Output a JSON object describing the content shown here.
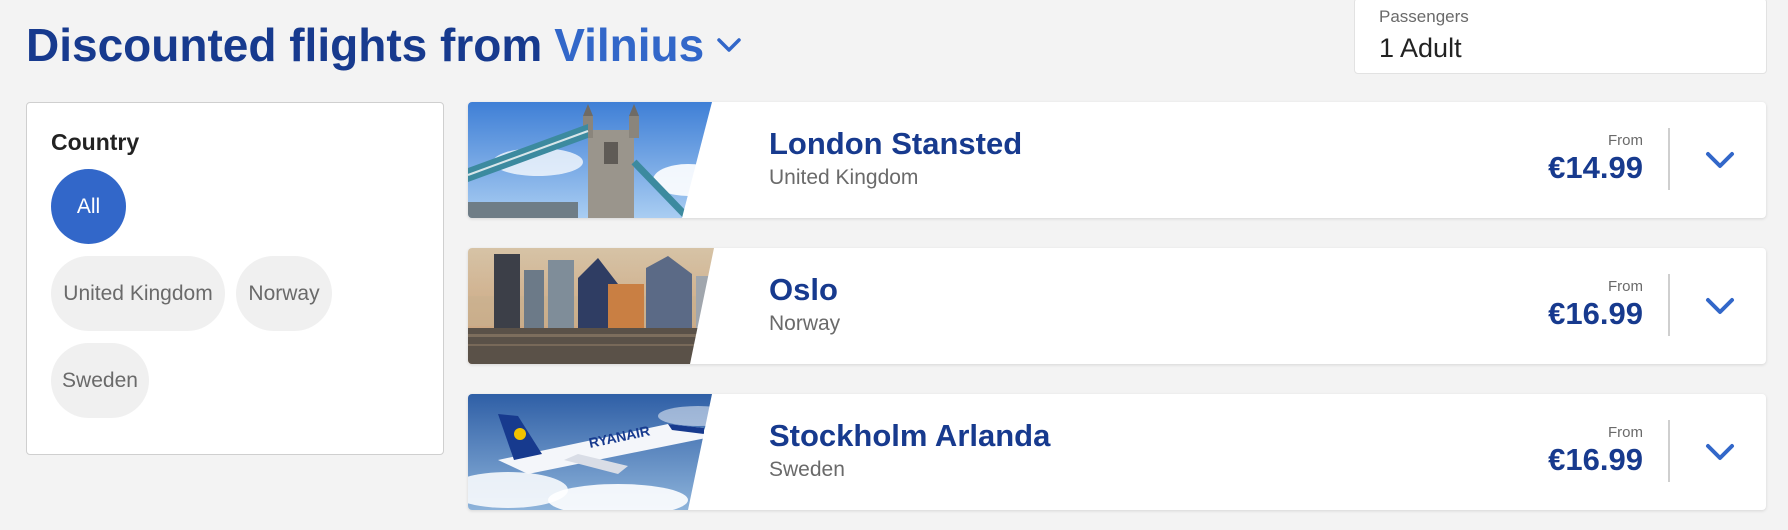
{
  "header": {
    "title_prefix": "Discounted flights from",
    "origin_city": "Vilnius"
  },
  "passengers": {
    "label": "Passengers",
    "value": "1 Adult"
  },
  "filter": {
    "heading": "Country",
    "chips": [
      {
        "label": "All",
        "active": true
      },
      {
        "label": "United Kingdom",
        "active": false
      },
      {
        "label": "Norway",
        "active": false
      },
      {
        "label": "Sweden",
        "active": false
      }
    ]
  },
  "destinations": [
    {
      "city": "London Stansted",
      "country": "United Kingdom",
      "from_label": "From",
      "price": "€14.99",
      "image": "tower-bridge"
    },
    {
      "city": "Oslo",
      "country": "Norway",
      "from_label": "From",
      "price": "€16.99",
      "image": "oslo-skyline"
    },
    {
      "city": "Stockholm Arlanda",
      "country": "Sweden",
      "from_label": "From",
      "price": "€16.99",
      "image": "ryanair-plane",
      "image_text": "RYANAIR"
    }
  ],
  "colors": {
    "brand_dark": "#173a8e",
    "brand_light": "#3267c9",
    "background": "#f3f3f3"
  }
}
